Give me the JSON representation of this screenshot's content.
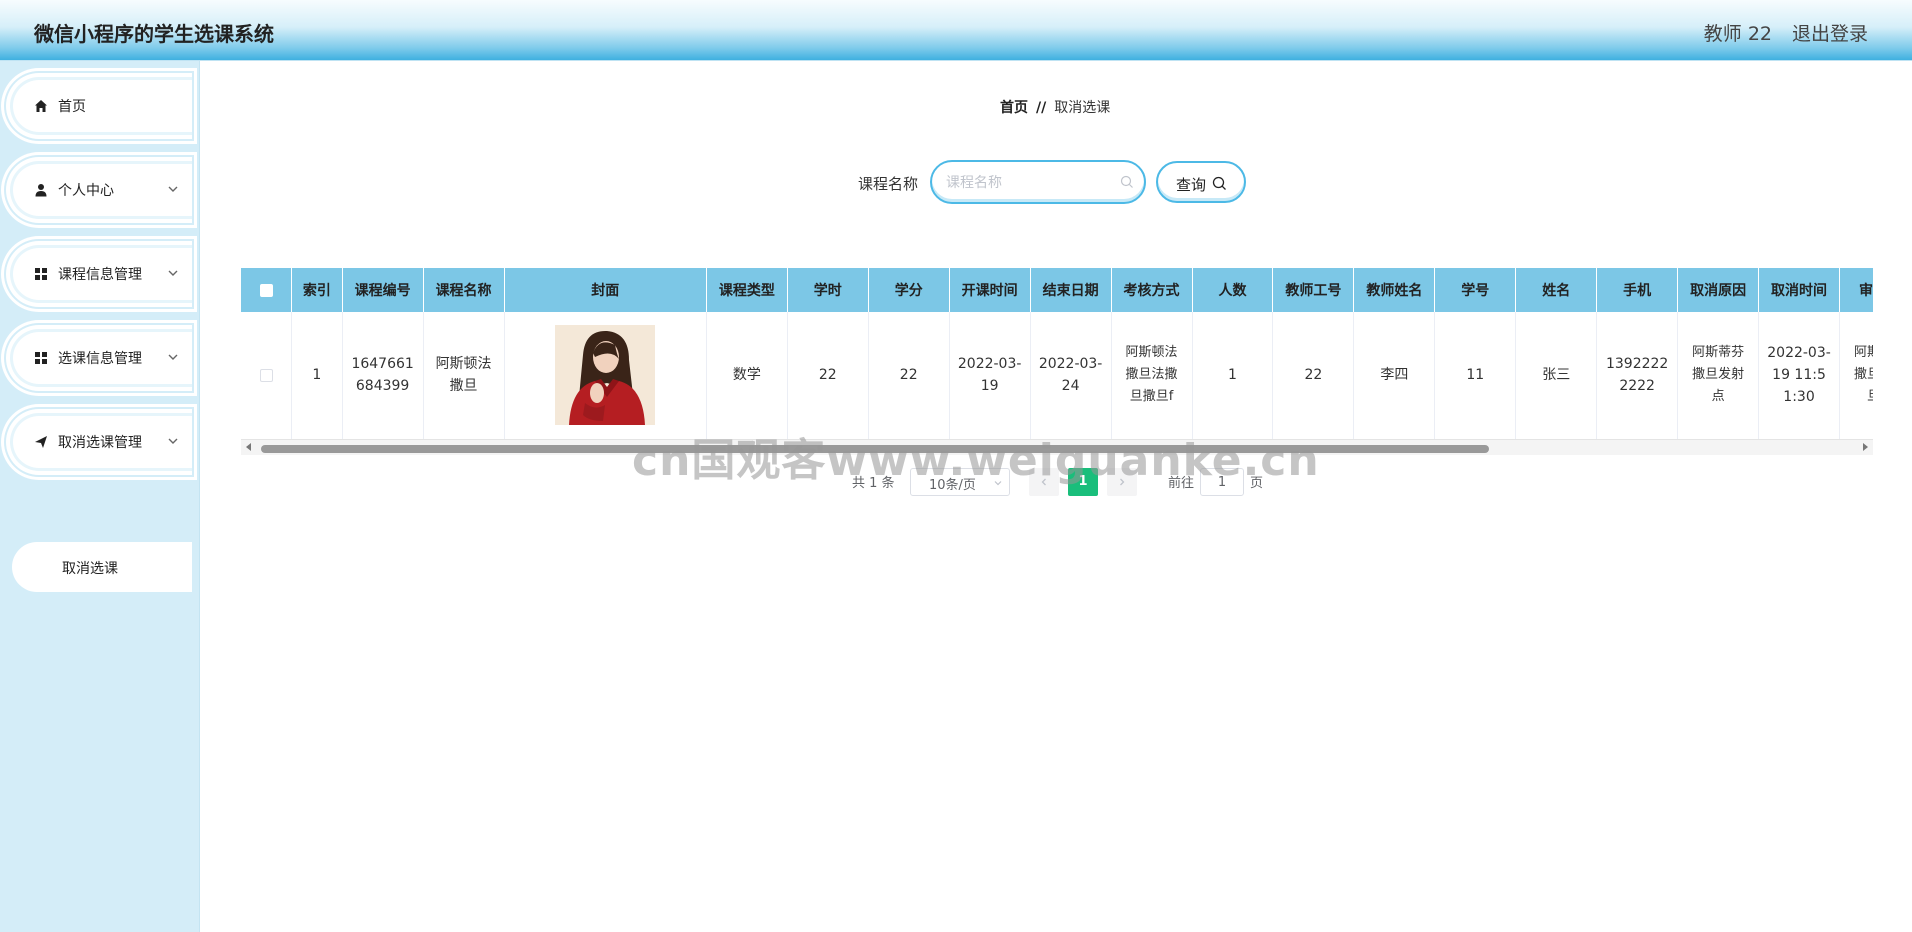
{
  "header": {
    "app_title": "微信小程序的学生选课系统",
    "user": "教师 22",
    "logout": "退出登录"
  },
  "sidebar": {
    "items": [
      {
        "label": "首页",
        "icon": "home-icon"
      },
      {
        "label": "个人中心",
        "icon": "user-icon"
      },
      {
        "label": "课程信息管理",
        "icon": "grid-icon"
      },
      {
        "label": "选课信息管理",
        "icon": "grid-icon"
      },
      {
        "label": "取消选课管理",
        "icon": "send-icon"
      }
    ],
    "submenu": {
      "label": "取消选课"
    }
  },
  "breadcrumb": {
    "home": "首页",
    "separator": "//",
    "current": "取消选课"
  },
  "search": {
    "label": "课程名称",
    "placeholder": "课程名称",
    "value": "",
    "button": "查询"
  },
  "table": {
    "headers": [
      "索引",
      "课程编号",
      "课程名称",
      "封面",
      "课程类型",
      "学时",
      "学分",
      "开课时间",
      "结束日期",
      "考核方式",
      "人数",
      "教师工号",
      "教师姓名",
      "学号",
      "姓名",
      "手机",
      "取消原因",
      "取消时间",
      "审核回"
    ],
    "rows": [
      {
        "index": "1",
        "course_no": "1647661684399",
        "course_name": "阿斯顿法撒旦",
        "course_type": "数学",
        "hours": "22",
        "credits": "22",
        "start": "2022-03-19",
        "end": "2022-03-24",
        "assessment": "阿斯顿法撒旦法撒旦撒旦f",
        "count": "1",
        "teacher_no": "22",
        "teacher_name": "李四",
        "student_no": "11",
        "student_name": "张三",
        "phone": "13922222222",
        "reason": "阿斯蒂芬撒旦发射点",
        "cancel_time": "2022-03-19 11:51:30",
        "review": "阿斯顿法撒旦法撒旦撒"
      }
    ]
  },
  "pagination": {
    "total": "共 1 条",
    "page_size": "10条/页",
    "current": "1",
    "goto_label": "前往",
    "goto_value": "1",
    "page_suffix": "页"
  },
  "watermark": "cn国观客www.weiguanke.cn",
  "colors": {
    "accent": "#4cb9e6",
    "table_header": "#7cc7e6",
    "sidebar_bg": "#d4edf8",
    "page_active": "#19be7b"
  }
}
